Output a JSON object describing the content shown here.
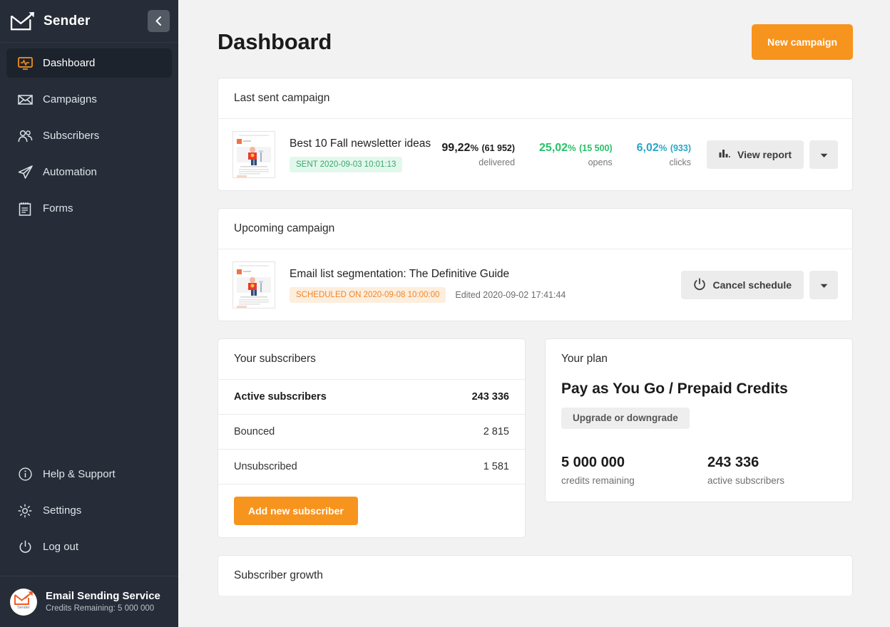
{
  "brand": {
    "name": "Sender",
    "logo_icon": "envelope-arrow-logo-icon"
  },
  "sidebar": {
    "collapse_icon": "chevron-left-icon",
    "items": [
      {
        "label": "Dashboard",
        "icon": "monitor-pulse-icon",
        "active": true
      },
      {
        "label": "Campaigns",
        "icon": "envelope-icon",
        "active": false
      },
      {
        "label": "Subscribers",
        "icon": "users-icon",
        "active": false
      },
      {
        "label": "Automation",
        "icon": "paper-plane-icon",
        "active": false
      },
      {
        "label": "Forms",
        "icon": "clipboard-icon",
        "active": false
      }
    ],
    "bottom_items": [
      {
        "label": "Help & Support",
        "icon": "info-circle-icon"
      },
      {
        "label": "Settings",
        "icon": "gear-icon"
      },
      {
        "label": "Log out",
        "icon": "power-icon"
      }
    ],
    "account": {
      "name": "Email Sending Service",
      "credits": "Credits Remaining: 5 000 000",
      "avatar_icon": "sender-avatar-icon",
      "avatar_label": "Sender"
    }
  },
  "header": {
    "title": "Dashboard",
    "new_campaign_label": "New campaign"
  },
  "last_sent": {
    "card_title": "Last sent campaign",
    "campaign_name": "Best 10 Fall newsletter ideas",
    "status_badge": "SENT 2020-09-03 10:01:13",
    "stats": [
      {
        "percent": "99,22",
        "pct_symbol": "%",
        "count": "(61 952)",
        "label": "delivered",
        "color": "#1c1c1c"
      },
      {
        "percent": "25,02",
        "pct_symbol": "%",
        "count": "(15 500)",
        "label": "opens",
        "color": "#27c267"
      },
      {
        "percent": "6,02",
        "pct_symbol": "%",
        "count": "(933)",
        "label": "clicks",
        "color": "#2aa5c7"
      }
    ],
    "action_label": "View report",
    "action_icon": "bar-chart-icon",
    "caret_icon": "caret-down-icon"
  },
  "upcoming": {
    "card_title": "Upcoming campaign",
    "campaign_name": "Email list segmentation: The Definitive Guide",
    "status_badge": "SCHEDULED ON 2020-09-08 10:00:00",
    "edited": "Edited 2020-09-02 17:41:44",
    "action_label": "Cancel schedule",
    "action_icon": "power-icon",
    "caret_icon": "caret-down-icon"
  },
  "subscribers": {
    "card_title": "Your subscribers",
    "rows": [
      {
        "label": "Active subscribers",
        "value": "243 336"
      },
      {
        "label": "Bounced",
        "value": "2 815"
      },
      {
        "label": "Unsubscribed",
        "value": "1 581"
      }
    ],
    "add_label": "Add new subscriber"
  },
  "plan": {
    "card_title": "Your plan",
    "plan_name": "Pay as You Go / Prepaid Credits",
    "upgrade_label": "Upgrade or downgrade",
    "metrics": [
      {
        "value": "5 000 000",
        "label": "credits remaining"
      },
      {
        "value": "243 336",
        "label": "active subscribers"
      }
    ]
  },
  "growth": {
    "card_title": "Subscriber growth"
  },
  "colors": {
    "accent": "#f7941e",
    "sidebar_bg": "#262d38",
    "sidebar_active_bg": "#1d232c",
    "green": "#27c267",
    "blue": "#2aa5c7",
    "page_bg": "#f2f2f2"
  }
}
